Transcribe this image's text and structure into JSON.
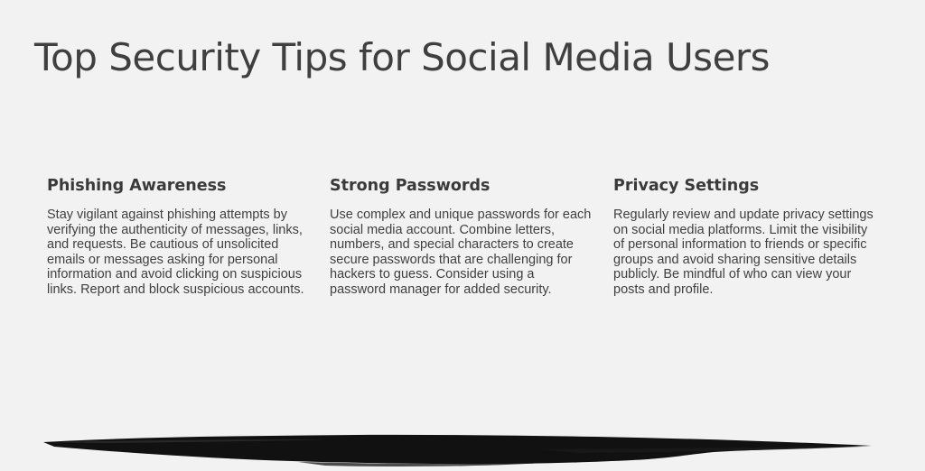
{
  "slide": {
    "title": "Top Security Tips for Social Media Users"
  },
  "tips": [
    {
      "heading": "Phishing Awareness",
      "body": "Stay vigilant against phishing attempts by verifying the authenticity of messages, links, and requests. Be cautious of unsolicited emails or messages asking for personal information and avoid clicking on suspicious links. Report and block suspicious accounts."
    },
    {
      "heading": "Strong Passwords",
      "body": "Use complex and unique passwords for each social media account. Combine letters, numbers, and special characters to create secure passwords that are challenging for hackers to guess. Consider using a password manager for added security."
    },
    {
      "heading": "Privacy Settings",
      "body": "Regularly review and update privacy settings on social media platforms. Limit the visibility of personal information to friends or specific groups and avoid sharing sensitive details publicly. Be mindful of who can view your posts and profile."
    }
  ],
  "colors": {
    "background": "#f2f2f2",
    "text": "#404040",
    "brush_stroke": "#111111"
  }
}
